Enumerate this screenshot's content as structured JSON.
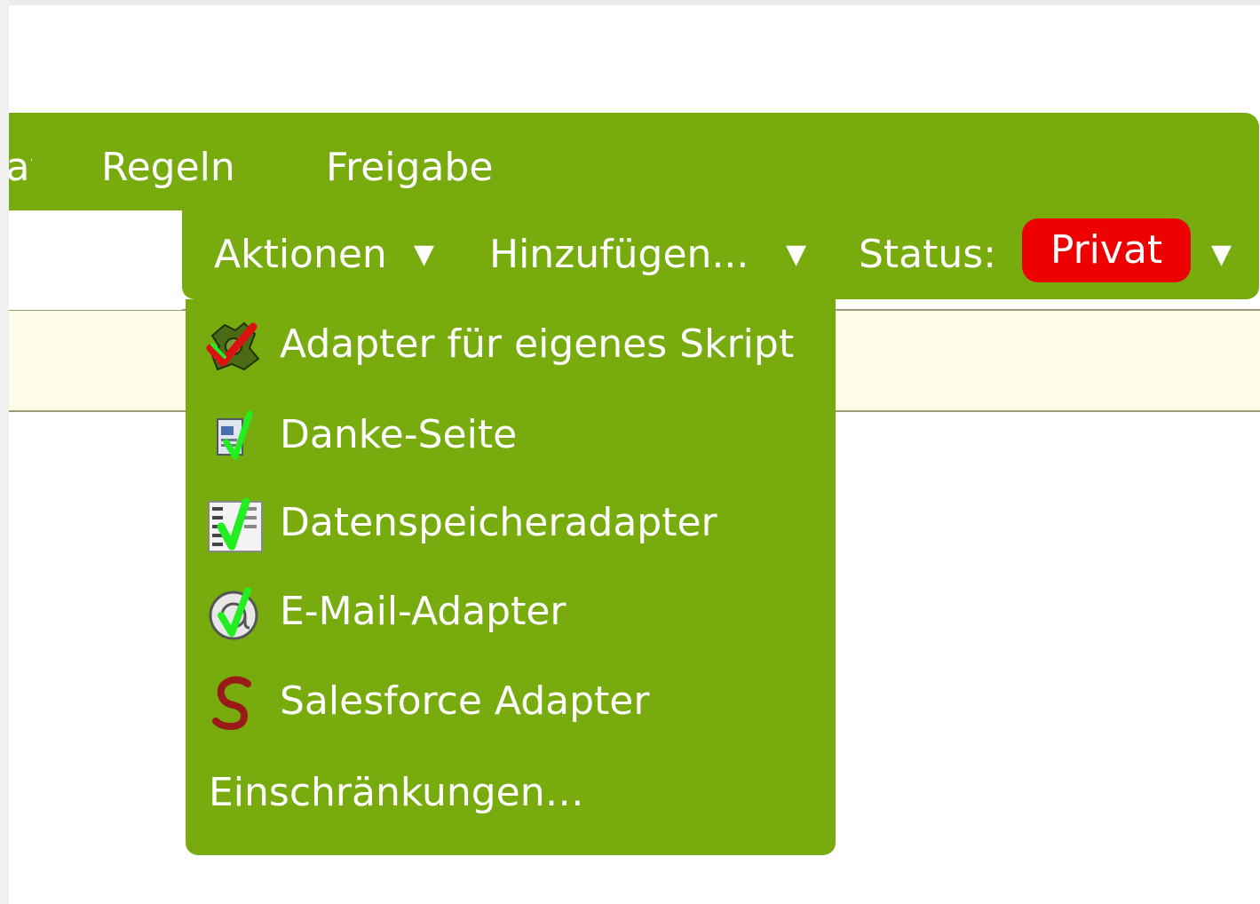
{
  "tabs": {
    "partial": "Layout",
    "regeln": "Regeln",
    "freigabe": "Freigabe"
  },
  "toolbar": {
    "aktionen": "Aktionen",
    "hinzufuegen": "Hinzufügen...",
    "status_label": "Status:",
    "status_value": "Privat",
    "arrow": "▼"
  },
  "menu": {
    "items": [
      {
        "label": "Adapter für eigenes Skript",
        "icon": "custom-script-adapter-icon"
      },
      {
        "label": "Danke-Seite",
        "icon": "thank-you-page-icon"
      },
      {
        "label": "Datenspeicheradapter",
        "icon": "data-store-adapter-icon"
      },
      {
        "label": "E-Mail-Adapter",
        "icon": "email-adapter-icon"
      },
      {
        "label": "Salesforce Adapter",
        "icon": "salesforce-icon"
      },
      {
        "label": "Einschränkungen…",
        "icon": ""
      }
    ]
  },
  "colors": {
    "bar_green": "#77ab0e",
    "status_red": "#ee0000",
    "info_bg": "#fffde8",
    "check_green": "#22ee22",
    "check_red": "#dd1111",
    "salesforce_maroon": "#9a1a1a"
  }
}
